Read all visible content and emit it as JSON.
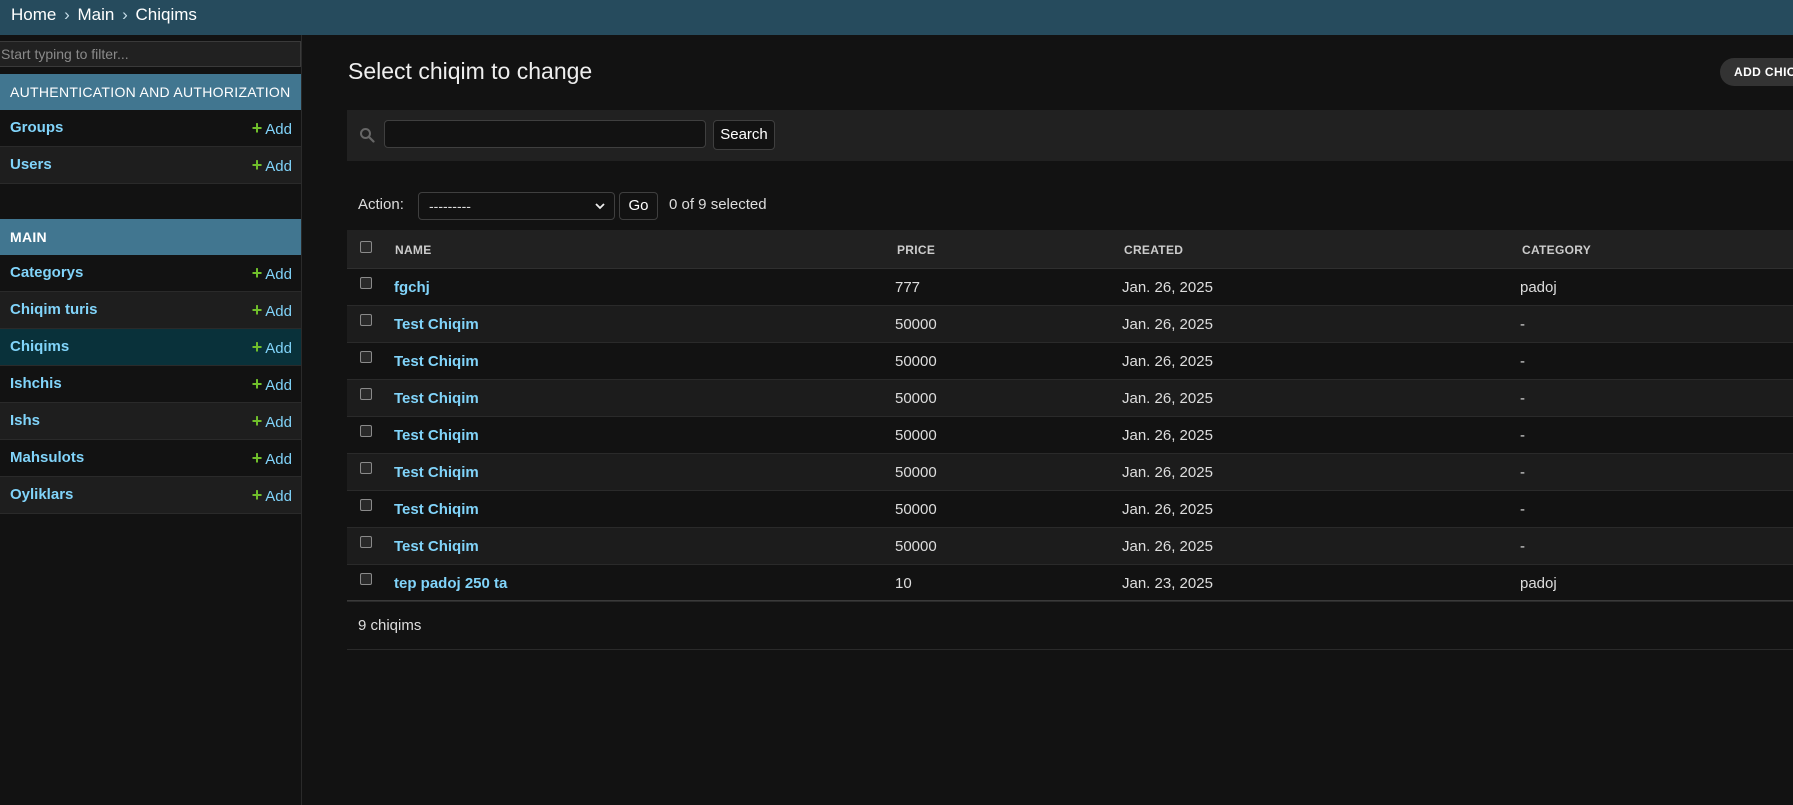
{
  "breadcrumb": {
    "home": "Home",
    "sep": "›",
    "main": "Main",
    "current": "Chiqims"
  },
  "sidebar": {
    "filter_placeholder": "Start typing to filter...",
    "apps": [
      {
        "caption": "AUTHENTICATION AND AUTHORIZATION",
        "models": [
          {
            "name": "Groups",
            "add": "Add"
          },
          {
            "name": "Users",
            "add": "Add"
          }
        ]
      },
      {
        "caption": "MAIN",
        "models": [
          {
            "name": "Categorys",
            "add": "Add"
          },
          {
            "name": "Chiqim turis",
            "add": "Add"
          },
          {
            "name": "Chiqims",
            "add": "Add"
          },
          {
            "name": "Ishchis",
            "add": "Add"
          },
          {
            "name": "Ishs",
            "add": "Add"
          },
          {
            "name": "Mahsulots",
            "add": "Add"
          },
          {
            "name": "Oyliklars",
            "add": "Add"
          }
        ]
      }
    ]
  },
  "content": {
    "title": "Select chiqim to change",
    "add_button": "ADD CHIC",
    "search_button": "Search",
    "search_value": "",
    "action_label": "Action:",
    "action_selected": "---------",
    "go_button": "Go",
    "selected_count": "0 of 9 selected",
    "columns": [
      "NAME",
      "PRICE",
      "CREATED",
      "CATEGORY"
    ],
    "rows": [
      {
        "name": "fgchj",
        "price": "777",
        "created": "Jan. 26, 2025",
        "category": "padoj"
      },
      {
        "name": "Test Chiqim",
        "price": "50000",
        "created": "Jan. 26, 2025",
        "category": "-"
      },
      {
        "name": "Test Chiqim",
        "price": "50000",
        "created": "Jan. 26, 2025",
        "category": "-"
      },
      {
        "name": "Test Chiqim",
        "price": "50000",
        "created": "Jan. 26, 2025",
        "category": "-"
      },
      {
        "name": "Test Chiqim",
        "price": "50000",
        "created": "Jan. 26, 2025",
        "category": "-"
      },
      {
        "name": "Test Chiqim",
        "price": "50000",
        "created": "Jan. 26, 2025",
        "category": "-"
      },
      {
        "name": "Test Chiqim",
        "price": "50000",
        "created": "Jan. 26, 2025",
        "category": "-"
      },
      {
        "name": "Test Chiqim",
        "price": "50000",
        "created": "Jan. 26, 2025",
        "category": "-"
      },
      {
        "name": "tep padoj 250 ta",
        "price": "10",
        "created": "Jan. 23, 2025",
        "category": "padoj"
      }
    ],
    "result_count": "9 chiqims"
  },
  "colors": {
    "header_bar": "#264b5d",
    "app_caption": "#417690",
    "link": "#81d4fa",
    "add_plus": "#70bf2b",
    "current_row": "#09313a",
    "background": "#121212"
  },
  "icons": {
    "search": "search-icon",
    "add": "plus-icon",
    "select": "chevron-down-icon"
  }
}
